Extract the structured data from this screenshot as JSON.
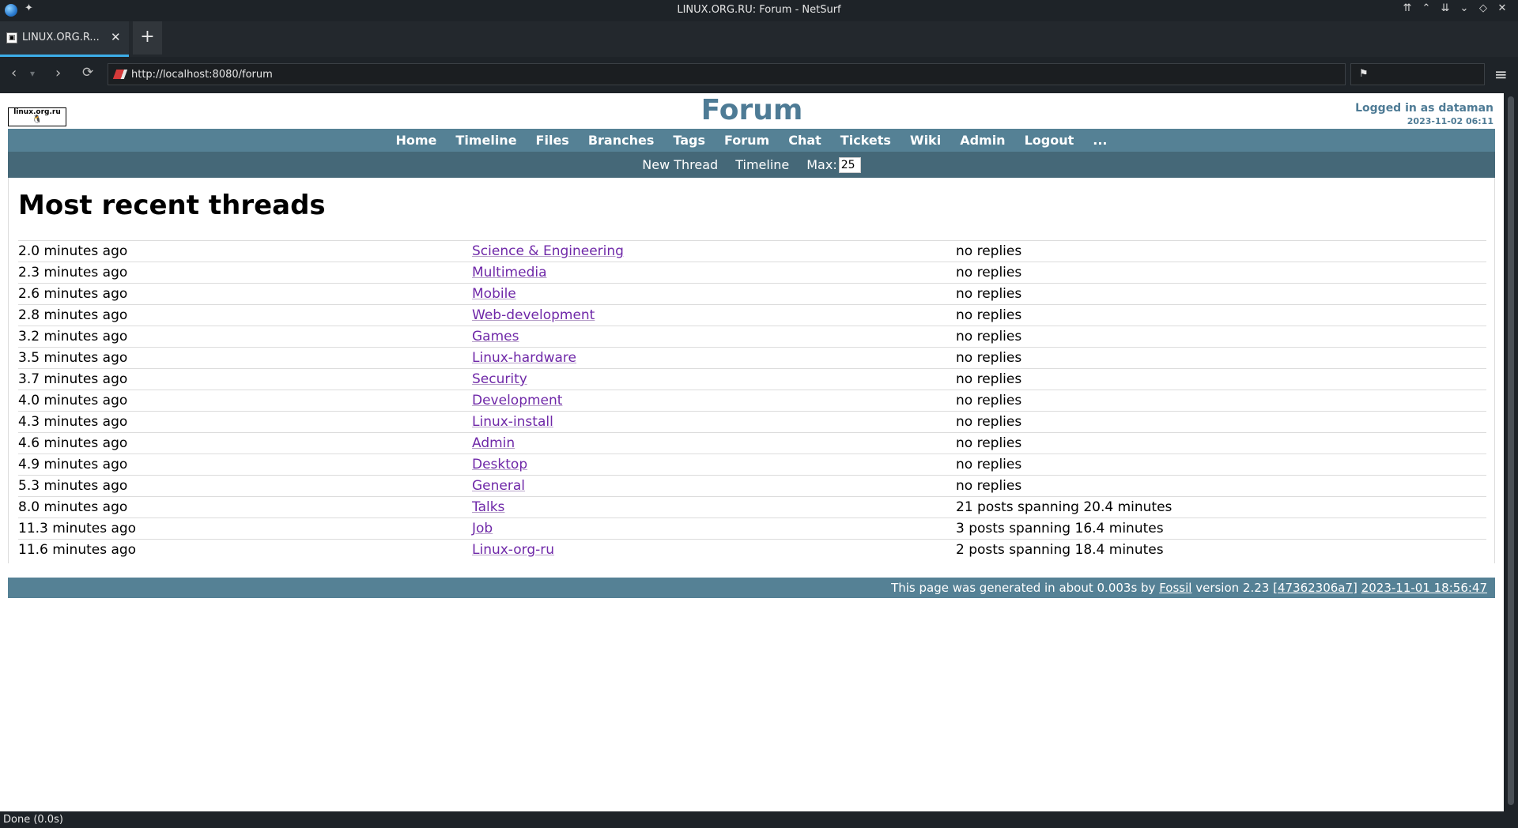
{
  "window": {
    "title": "LINUX.ORG.RU: Forum - NetSurf"
  },
  "tab": {
    "label": "LINUX.ORG.R...",
    "close": "✕",
    "new": "+"
  },
  "nav": {
    "url": "http://localhost:8080/forum"
  },
  "header": {
    "logo_text": "linux.org.ru",
    "title": "Forum",
    "login": "Logged in as dataman",
    "date": "2023-11-02 06:11"
  },
  "mainmenu": [
    "Home",
    "Timeline",
    "Files",
    "Branches",
    "Tags",
    "Forum",
    "Chat",
    "Tickets",
    "Wiki",
    "Admin",
    "Logout",
    "..."
  ],
  "submenu": {
    "new_thread": "New Thread",
    "timeline": "Timeline",
    "max_label": "Max:",
    "max_value": "25"
  },
  "page": {
    "heading": "Most recent threads"
  },
  "threads": [
    {
      "age": "2.0 minutes ago",
      "title": "Science & Engineering",
      "info": "no replies"
    },
    {
      "age": "2.3 minutes ago",
      "title": "Multimedia",
      "info": "no replies"
    },
    {
      "age": "2.6 minutes ago",
      "title": "Mobile",
      "info": "no replies"
    },
    {
      "age": "2.8 minutes ago",
      "title": "Web-development",
      "info": "no replies"
    },
    {
      "age": "3.2 minutes ago",
      "title": "Games",
      "info": "no replies"
    },
    {
      "age": "3.5 minutes ago",
      "title": "Linux-hardware",
      "info": "no replies"
    },
    {
      "age": "3.7 minutes ago",
      "title": "Security",
      "info": "no replies"
    },
    {
      "age": "4.0 minutes ago",
      "title": "Development",
      "info": "no replies"
    },
    {
      "age": "4.3 minutes ago",
      "title": "Linux-install",
      "info": "no replies"
    },
    {
      "age": "4.6 minutes ago",
      "title": "Admin",
      "info": "no replies"
    },
    {
      "age": "4.9 minutes ago",
      "title": "Desktop",
      "info": "no replies"
    },
    {
      "age": "5.3 minutes ago",
      "title": "General",
      "info": "no replies"
    },
    {
      "age": "8.0 minutes ago",
      "title": "Talks",
      "info": "21 posts spanning 20.4 minutes"
    },
    {
      "age": "11.3 minutes ago",
      "title": "Job",
      "info": "3 posts spanning 16.4 minutes"
    },
    {
      "age": "11.6 minutes ago",
      "title": "Linux-org-ru",
      "info": "2 posts spanning 18.4 minutes"
    }
  ],
  "footer": {
    "prefix": "This page was generated in about 0.003s by ",
    "fossil": "Fossil",
    "version": " version 2.23 ",
    "hash": "[47362306a7]",
    "datetime": "2023-11-01 18:56:47"
  },
  "status": {
    "text": "Done (0.0s)"
  },
  "colors": {
    "accent": "#558195",
    "submenu": "#456878",
    "link": "#6f28a8",
    "title": "#4e7b95"
  }
}
